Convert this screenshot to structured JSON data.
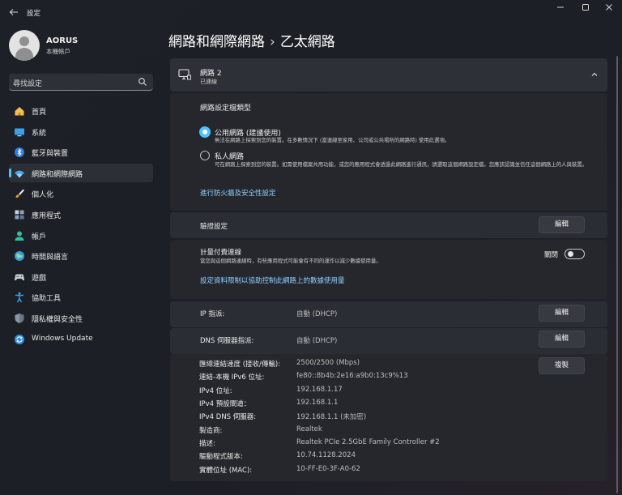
{
  "window": {
    "title": "設定",
    "controls": [
      "minimize",
      "maximize",
      "close"
    ]
  },
  "profile": {
    "name": "AORUS",
    "account_type": "本機帳戶"
  },
  "search": {
    "placeholder": "尋找設定"
  },
  "sidebar": {
    "items": [
      {
        "label": "首頁",
        "icon": "home-icon"
      },
      {
        "label": "系統",
        "icon": "system-icon"
      },
      {
        "label": "藍牙與裝置",
        "icon": "bluetooth-icon"
      },
      {
        "label": "網路和網際網路",
        "icon": "wifi-icon",
        "active": true
      },
      {
        "label": "個人化",
        "icon": "brush-icon"
      },
      {
        "label": "應用程式",
        "icon": "apps-icon"
      },
      {
        "label": "帳戶",
        "icon": "account-icon"
      },
      {
        "label": "時間與語言",
        "icon": "globe-icon"
      },
      {
        "label": "遊戲",
        "icon": "gamepad-icon"
      },
      {
        "label": "協助工具",
        "icon": "accessibility-icon"
      },
      {
        "label": "隱私權與安全性",
        "icon": "shield-icon"
      },
      {
        "label": "Windows Update",
        "icon": "update-icon"
      }
    ]
  },
  "header": {
    "breadcrumb_parent": "網路和網際網路",
    "separator": "›",
    "breadcrumb_current": "乙太網路"
  },
  "network": {
    "name": "網路 2",
    "status": "已連線"
  },
  "profile_type": {
    "heading": "網路設定檔類型",
    "options": [
      {
        "title": "公用網路 (建議使用)",
        "description": "無法在網路上探索到您的裝置。在多數情況下 (當連線至家用、公司或公共場所的網路時) 使用此選項。",
        "selected": true
      },
      {
        "title": "私人網路",
        "description": "可在網路上探索到您的裝置。如需使用檔案共用功能，或您的應用程式會透過此網路進行通訊，請選取這個網路設定檔。您應該認識並信任這個網路上的人與裝置。",
        "selected": false
      }
    ],
    "firewall_link": "進行防火牆及安全性設定"
  },
  "auth": {
    "label": "驗證設定",
    "button": "編輯"
  },
  "metered": {
    "label": "計量付費連線",
    "description": "當您與這個網路連線時，有些應用程式可能會有不同的運作以減少數據使用量。",
    "toggle_state_label": "關閉",
    "toggle_on": false,
    "data_limit_link": "設定資料限制以協助控制此網路上的數據使用量"
  },
  "ip_assignment": {
    "label": "IP 指派:",
    "value": "自動 (DHCP)",
    "button": "編輯"
  },
  "dns_assignment": {
    "label": "DNS 伺服器指派:",
    "value": "自動 (DHCP)",
    "button": "編輯"
  },
  "properties": {
    "copy_button": "複製",
    "rows": [
      {
        "key": "匯總連結速度 (接收/傳輸):",
        "value": "2500/2500 (Mbps)"
      },
      {
        "key": "連結-本機 IPv6 位址:",
        "value": "fe80::8b4b:2e16:a9b0:13c9%13"
      },
      {
        "key": "IPv4 位址:",
        "value": "192.168.1.17"
      },
      {
        "key": "IPv4 預設閘道：",
        "value": "192.168.1.1"
      },
      {
        "key": "IPv4 DNS 伺服器:",
        "value": "192.168.1.1 (未加密)"
      },
      {
        "key": "製造商:",
        "value": "Realtek"
      },
      {
        "key": "描述:",
        "value": "Realtek PCIe 2.5GbE Family Controller #2"
      },
      {
        "key": "驅動程式版本:",
        "value": "10.74.1128.2024"
      },
      {
        "key": "實體位址 (MAC):",
        "value": "10-FF-E0-3F-A0-62"
      }
    ]
  },
  "colors": {
    "accent": "#4cc2ff",
    "link": "#8fd0ff",
    "background": "#1d2027",
    "card": "#2b2d34"
  }
}
